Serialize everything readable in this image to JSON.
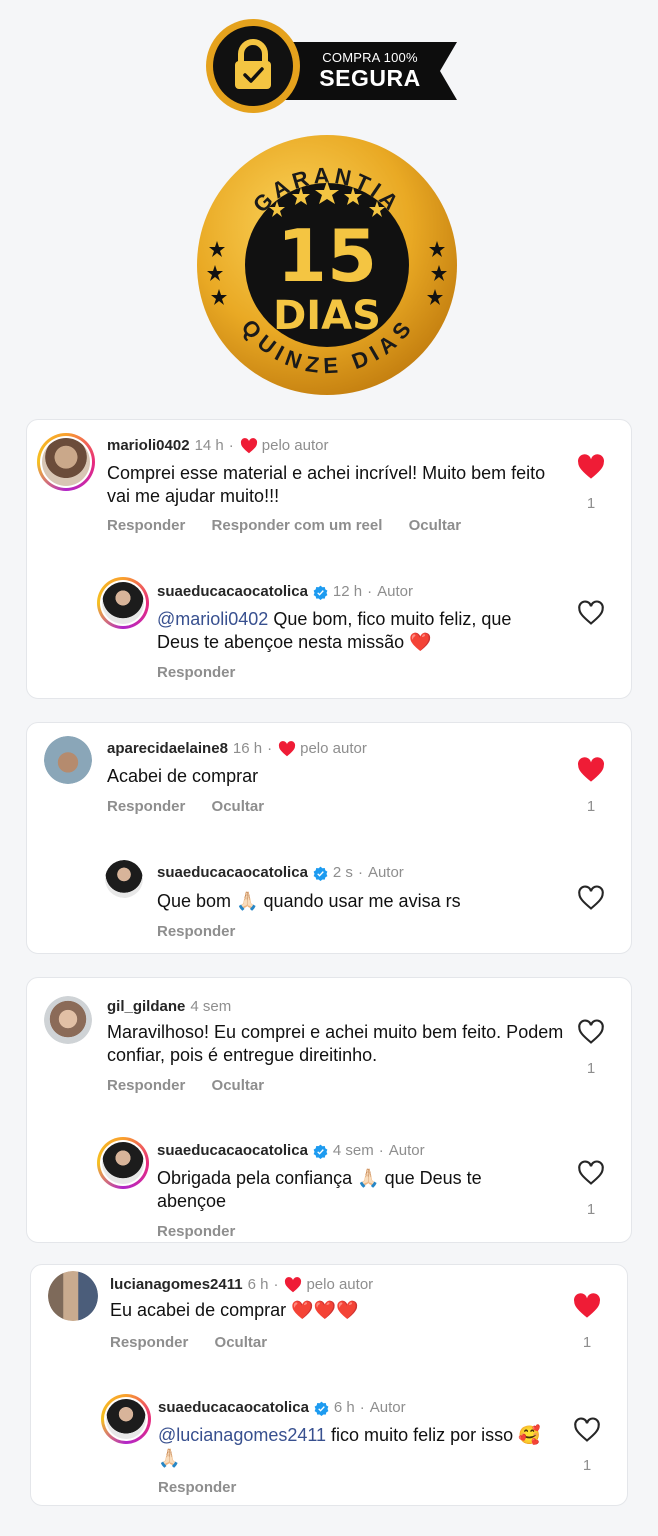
{
  "badge": {
    "line1": "COMPRA 100%",
    "line2": "SEGURA"
  },
  "seal": {
    "top": "GARANTIA",
    "number": "15",
    "word": "DIAS",
    "bottom": "QUINZE DIAS"
  },
  "colors": {
    "gold": "#e9a924",
    "like_red": "#ef1c36",
    "mention": "#38508f",
    "muted": "#8e8e8e"
  },
  "comments": [
    {
      "user": "marioli0402",
      "time": "14 h",
      "sep": "·",
      "liked_by_author": "pelo autor",
      "text": "Comprei esse material e achei incrível! Muito bem feito vai me ajudar muito!!!",
      "actions": [
        "Responder",
        "Responder com um reel",
        "Ocultar"
      ],
      "liked": true,
      "likes": "1",
      "reply": {
        "user": "suaeducacaocatolica",
        "time": "12 h",
        "sep": "·",
        "role": "Autor",
        "mention": "@marioli0402",
        "text": " Que bom, fico muito feliz, que Deus te abençoe nesta missão",
        "emoji": "❤️",
        "actions": [
          "Responder"
        ],
        "liked": false,
        "likes": ""
      }
    },
    {
      "user": "aparecidaelaine8",
      "time": "16 h",
      "sep": "·",
      "liked_by_author": "pelo autor",
      "text": "Acabei de comprar",
      "actions": [
        "Responder",
        "Ocultar"
      ],
      "liked": true,
      "likes": "1",
      "reply": {
        "user": "suaeducacaocatolica",
        "time": "2 s",
        "sep": "·",
        "role": "Autor",
        "text_a": "Que bom ",
        "emoji": "🙏🏻",
        "text_b": " quando usar me avisa rs",
        "actions": [
          "Responder"
        ],
        "liked": false,
        "likes": ""
      }
    },
    {
      "user": "gil_gildane",
      "time": "4 sem",
      "text": "Maravilhoso! Eu comprei e achei muito bem feito. Podem confiar, pois é entregue direitinho.",
      "actions": [
        "Responder",
        "Ocultar"
      ],
      "liked": false,
      "likes": "1",
      "reply": {
        "user": "suaeducacaocatolica",
        "time": "4 sem",
        "sep": "·",
        "role": "Autor",
        "text_a": "Obrigada pela confiança ",
        "emoji": "🙏🏻",
        "text_b": " que Deus te abençoe",
        "actions": [
          "Responder"
        ],
        "liked": false,
        "likes": "1"
      }
    },
    {
      "user": "lucianagomes2411",
      "time": "6 h",
      "sep": "·",
      "liked_by_author": "pelo autor",
      "text": "Eu acabei de comprar",
      "emoji": "❤️❤️❤️",
      "actions": [
        "Responder",
        "Ocultar"
      ],
      "liked": true,
      "likes": "1",
      "reply": {
        "user": "suaeducacaocatolica",
        "time": "6 h",
        "sep": "·",
        "role": "Autor",
        "mention": "@lucianagomes2411",
        "text": " fico muito feliz por isso",
        "emoji": "🥰🙏🏻",
        "actions": [
          "Responder"
        ],
        "liked": false,
        "likes": "1"
      }
    }
  ]
}
